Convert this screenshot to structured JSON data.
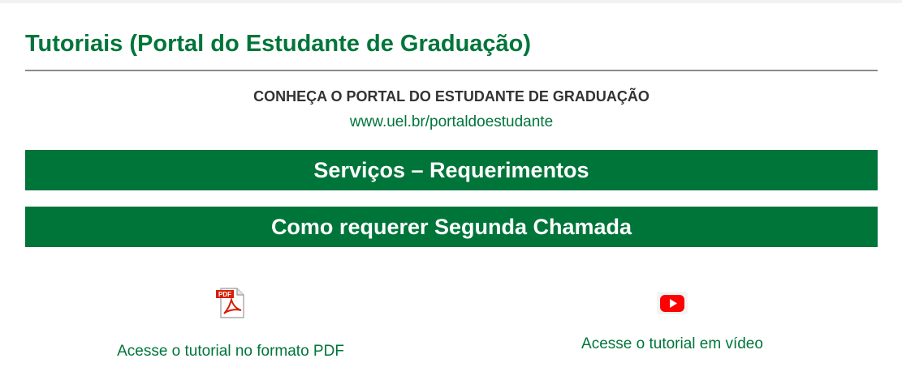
{
  "page": {
    "title": "Tutoriais (Portal do Estudante de Graduação)"
  },
  "intro": {
    "heading": "CONHEÇA O PORTAL DO ESTUDANTE DE GRADUAÇÃO",
    "link": "www.uel.br/portaldoestudante"
  },
  "sections": {
    "services_label": "Serviços – Requerimentos",
    "segunda_chamada_label": "Como requerer Segunda Chamada"
  },
  "tutorials": {
    "pdf": {
      "icon": "pdf-icon",
      "icon_text": "PDF",
      "label": "Acesse o tutorial no formato PDF"
    },
    "video": {
      "icon": "youtube-icon",
      "label": "Acesse o tutorial em vídeo"
    }
  },
  "colors": {
    "brand_green": "#00753a",
    "heading_gray": "#333333",
    "rule_gray": "#8a8a8a",
    "pdf_red": "#d81e05",
    "youtube_red": "#ff0000"
  }
}
